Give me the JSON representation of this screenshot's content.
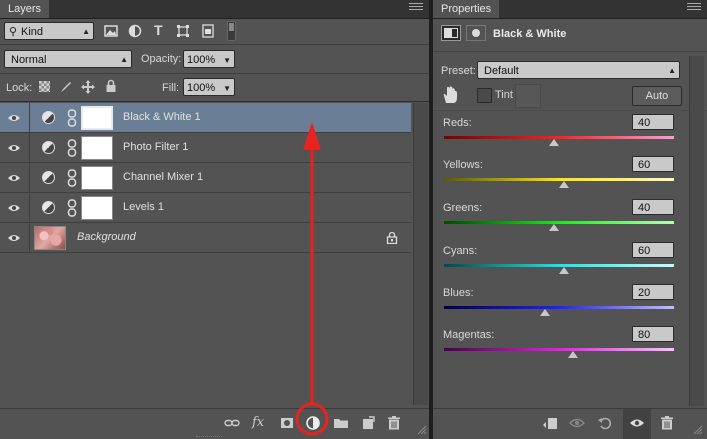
{
  "layers_panel": {
    "tab": "Layers",
    "filter_kind": "Kind",
    "blend_mode": "Normal",
    "opacity_label": "Opacity:",
    "opacity_value": "100%",
    "lock_label": "Lock:",
    "fill_label": "Fill:",
    "fill_value": "100%",
    "layers": [
      {
        "name": "Black & White 1",
        "selected": true
      },
      {
        "name": "Photo Filter 1",
        "selected": false
      },
      {
        "name": "Channel Mixer 1",
        "selected": false
      },
      {
        "name": "Levels 1",
        "selected": false
      },
      {
        "name": "Background",
        "selected": false
      }
    ],
    "bottom_fx": "fx"
  },
  "properties_panel": {
    "tab": "Properties",
    "title": "Black & White",
    "preset_label": "Preset:",
    "preset_value": "Default",
    "tint_label": "Tint",
    "auto_label": "Auto",
    "sliders": [
      {
        "label": "Reds:",
        "value": "40",
        "fraction": 0.48,
        "colors": [
          "#7a0000",
          "#ff2020",
          "#ff9ad0"
        ]
      },
      {
        "label": "Yellows:",
        "value": "60",
        "fraction": 0.52,
        "colors": [
          "#5a5a00",
          "#ffe600",
          "#fff9c0"
        ]
      },
      {
        "label": "Greens:",
        "value": "40",
        "fraction": 0.48,
        "colors": [
          "#004a00",
          "#1ee61e",
          "#b8ffb8"
        ]
      },
      {
        "label": "Cyans:",
        "value": "60",
        "fraction": 0.52,
        "colors": [
          "#004a4a",
          "#19e6e6",
          "#bfffff"
        ]
      },
      {
        "label": "Blues:",
        "value": "20",
        "fraction": 0.44,
        "colors": [
          "#00004a",
          "#2020ff",
          "#c0c0ff"
        ]
      },
      {
        "label": "Magentas:",
        "value": "80",
        "fraction": 0.56,
        "colors": [
          "#4a004a",
          "#e61ee6",
          "#ffc0ff"
        ]
      }
    ]
  },
  "annotation_color": "#e8231f"
}
